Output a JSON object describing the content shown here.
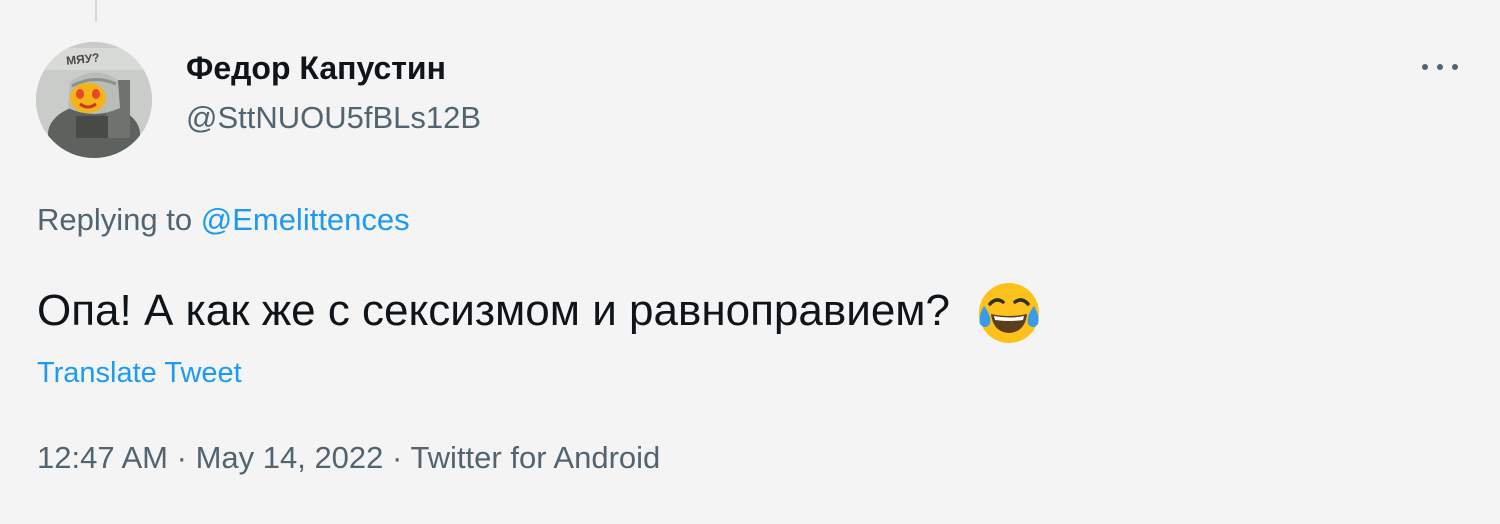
{
  "tweet": {
    "author": {
      "name": "Федор Капустин",
      "handle": "@SttNUOU5fBLs12B",
      "avatar_caption": "МЯУ?"
    },
    "more_icon": "more-horizontal-icon",
    "replying_prefix": "Replying to",
    "replying_mention": "@Emelittences",
    "text": "Опа! А как же с сексизмом и равноправием?",
    "emoji_icon": "face-with-tears-of-joy-emoji",
    "translate_label": "Translate Tweet",
    "time": "12:47 AM",
    "date": "May 14, 2022",
    "source": "Twitter for Android",
    "separator": "·"
  },
  "colors": {
    "background": "#f4f4f4",
    "text_primary": "#0f1419",
    "text_secondary": "#536471",
    "link": "#1d9bf0"
  }
}
